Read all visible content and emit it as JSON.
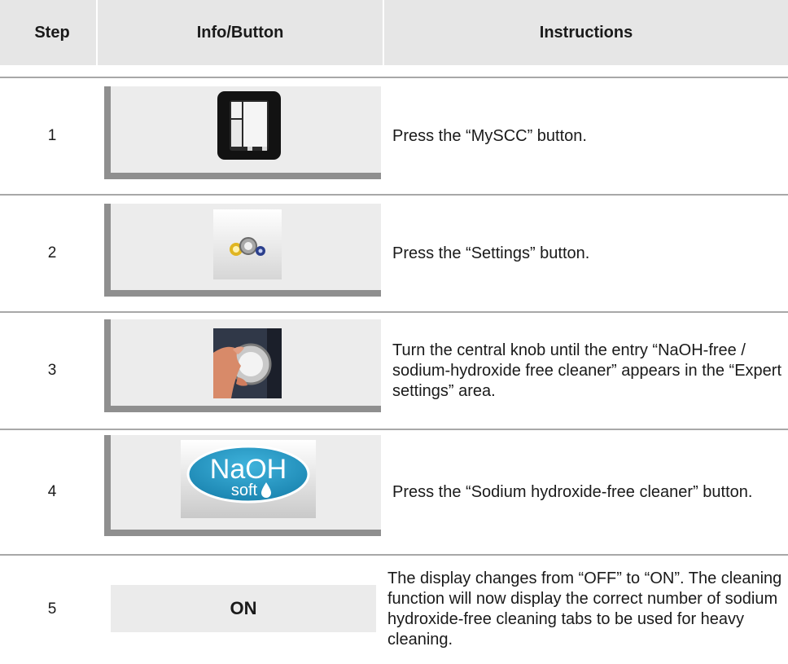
{
  "table": {
    "headers": {
      "step": "Step",
      "info": "Info/Button",
      "instructions": "Instructions"
    },
    "rows": [
      {
        "step": "1",
        "icon": "myscc-oven-icon",
        "instruction": "Press the “MySCC” button."
      },
      {
        "step": "2",
        "icon": "settings-gears-icon",
        "instruction": "Press the “Settings” button."
      },
      {
        "step": "3",
        "icon": "central-knob-icon",
        "instruction": "Turn the central knob until the entry “NaOH-free / sodium-hydroxide free cleaner” appears in the “Expert settings” area."
      },
      {
        "step": "4",
        "icon": "naoh-soft-icon",
        "logo_text": {
          "main": "NaOH",
          "sub": "soft"
        },
        "instruction": "Press the “Sodium hydroxide-free cleaner” button."
      },
      {
        "step": "5",
        "display_text": "ON",
        "instruction": "The display changes from “OFF” to “ON”. The cleaning function will now display the correct number of sodium hydroxide-free cleaning tabs to be used for heavy cleaning."
      }
    ]
  },
  "colors": {
    "header_bg": "#e6e6e6",
    "info_bg": "#ececec",
    "info_border": "#8f8f8f",
    "separator": "#a8a8a8",
    "naoh_blue": "#1f93be"
  }
}
